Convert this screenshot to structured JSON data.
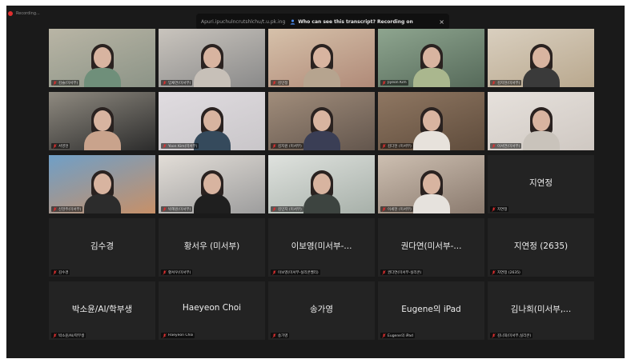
{
  "window": {
    "recording_label": "Recording...",
    "banner": {
      "url": "Apuri.ipuchulncrutshlchu/t.u.pk.ing",
      "notice": "Who can see this transcript? Recording on",
      "close_label": "×"
    }
  },
  "colors": {
    "background": "#1a1a1a",
    "tile": "#232323",
    "recording_red": "#e02f2f",
    "muted_mic": "#e02f2f"
  },
  "tiles": [
    {
      "kind": "video",
      "label": "김슬(미서부)",
      "bg": "#8c9487",
      "cam": "#b9b5a5",
      "shirt": "#6f8f7a"
    },
    {
      "kind": "video",
      "label": "임채연(미서부)",
      "bg": "#8a8a8a",
      "cam": "#c9c4bd",
      "shirt": "#c7c0b8"
    },
    {
      "kind": "video",
      "label": "김민정",
      "bg": "#b08a78",
      "cam": "#d6c1aa",
      "shirt": "#b6a48f"
    },
    {
      "kind": "video",
      "label": "Jiyeon Kim",
      "bg": "#566a5a",
      "cam": "#8ea58f",
      "shirt": "#aab78e"
    },
    {
      "kind": "video",
      "label": "김지현(미서부)",
      "bg": "#b9a88e",
      "cam": "#d9cfbf",
      "shirt": "#3a3a3a"
    },
    {
      "kind": "video",
      "label": "서영현",
      "bg": "#2c2c2c",
      "cam": "#8f8a80",
      "shirt": "#c9a38c"
    },
    {
      "kind": "video",
      "label": "Yoon Kim(미서부)",
      "bg": "#c9c6c9",
      "cam": "#e0dce0",
      "shirt": "#354a5c"
    },
    {
      "kind": "video",
      "label": "김지원 (미서부)",
      "bg": "#63564d",
      "cam": "#a18d7b",
      "shirt": "#3a3e55"
    },
    {
      "kind": "video",
      "label": "김다현 (미서부)",
      "bg": "#5f4c3c",
      "cam": "#8f7762",
      "shirt": "#e7e2dc"
    },
    {
      "kind": "video",
      "label": "이서연(미서부)",
      "bg": "#cfc8c2",
      "cam": "#e6e1dc",
      "shirt": "#c9c3bb"
    },
    {
      "kind": "video",
      "label": "신현주(미서부)",
      "bg": "#c79068",
      "cam": "#6f9fc7",
      "shirt": "#2c2c2c"
    },
    {
      "kind": "video",
      "label": "박혜원(미서부)",
      "bg": "#9d9d9d",
      "cam": "#e2ddd7",
      "shirt": "#1f1f1f"
    },
    {
      "kind": "video",
      "label": "김민지 (미서부)",
      "bg": "#a7b0a9",
      "cam": "#dfe2de",
      "shirt": "#3d4440"
    },
    {
      "kind": "video",
      "label": "이세현 (미서부)",
      "bg": "#8a7a6e",
      "cam": "#cdbfb1",
      "shirt": "#e6e2dd"
    },
    {
      "kind": "name",
      "name": "지연정",
      "label": "지연정"
    },
    {
      "kind": "name",
      "name": "김수경",
      "label": "김수경"
    },
    {
      "kind": "name",
      "name": "황서우 (미서부)",
      "label": "황서우(미서부)"
    },
    {
      "kind": "name",
      "name": "이보영(미서부-...",
      "label": "이보영(미서부-실리콘밸리)"
    },
    {
      "kind": "name",
      "name": "권다연(미서부-...",
      "label": "권다연(미서부-실리콘)"
    },
    {
      "kind": "name",
      "name": "지연정 (2635)",
      "label": "지연정 (2635)"
    },
    {
      "kind": "name",
      "name": "박소윤/AI/학부생",
      "label": "박소윤/AI/학부생"
    },
    {
      "kind": "name",
      "name": "Haeyeon Choi",
      "label": "Haeyeon Choi"
    },
    {
      "kind": "name",
      "name": "송가영",
      "label": "송가영"
    },
    {
      "kind": "name",
      "name": "Eugene의 iPad",
      "label": "Eugene의 iPad"
    },
    {
      "kind": "name",
      "name": "김나희(미서부,...",
      "label": "김나희(미서부,실리콘)"
    }
  ]
}
